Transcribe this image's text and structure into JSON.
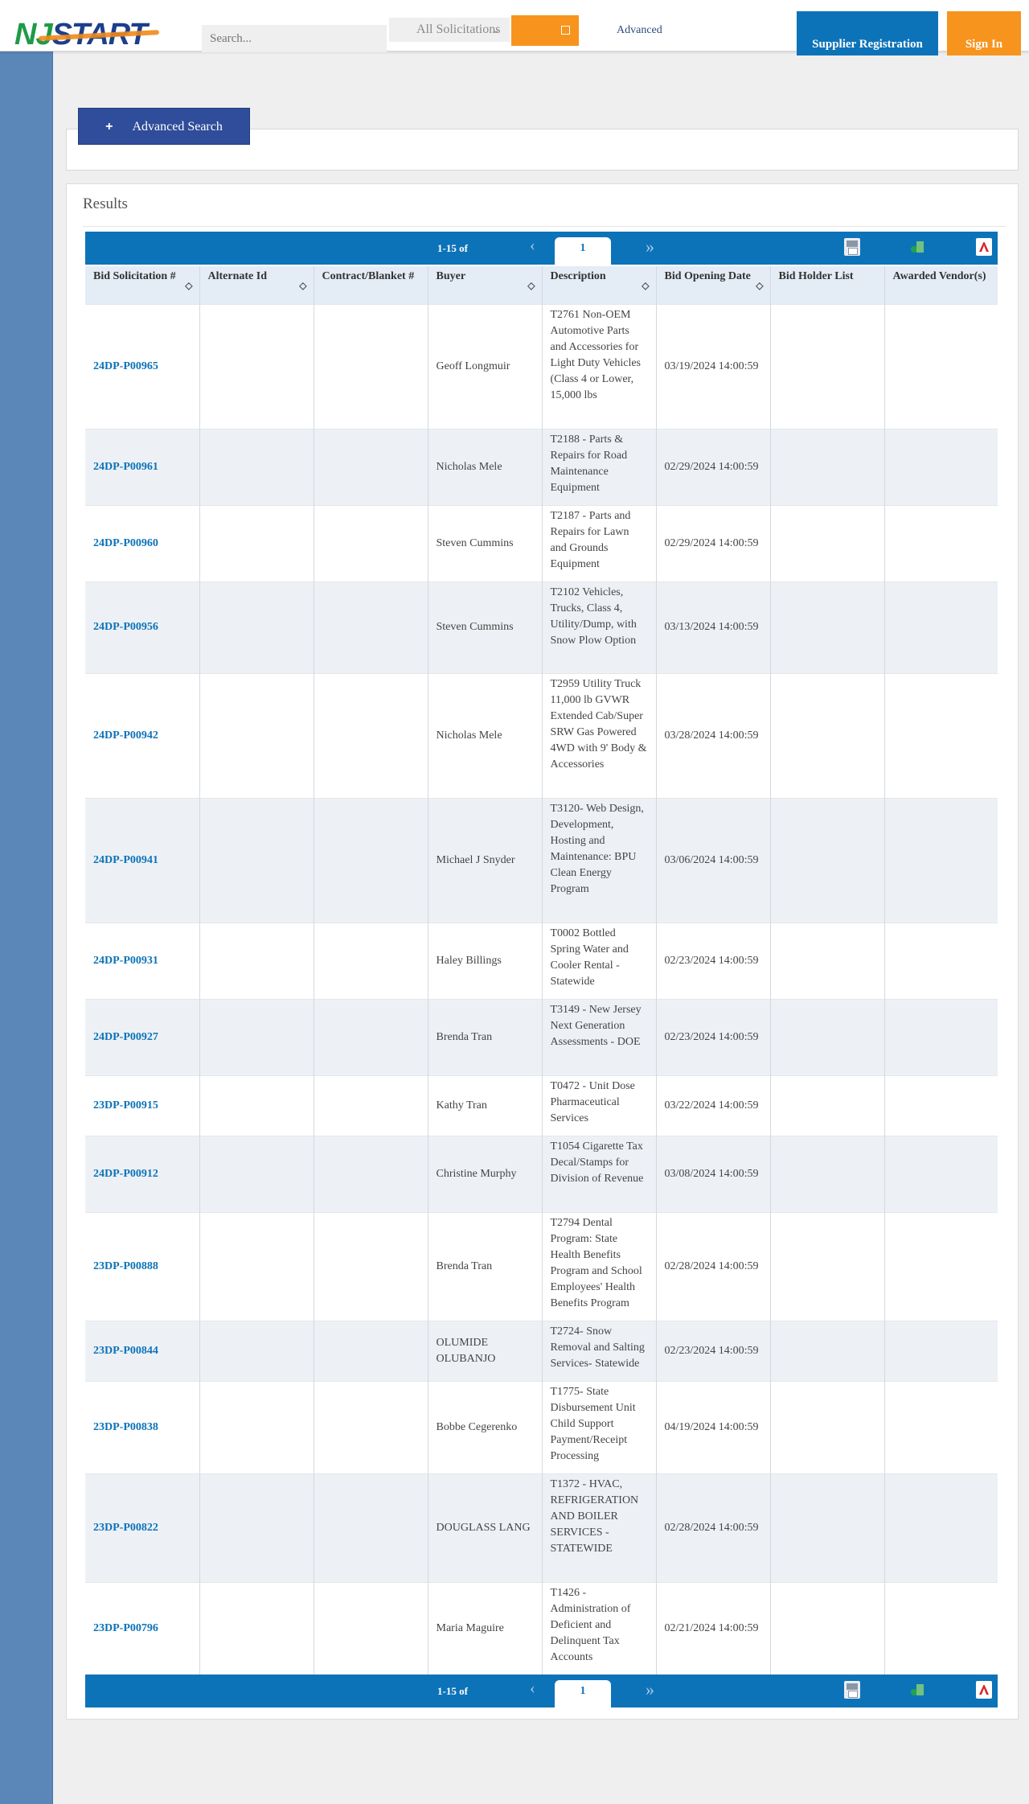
{
  "header": {
    "logo_nj": "NJ",
    "logo_start": "START",
    "search_placeholder": "Search...",
    "scope_label": "All Solicitations",
    "advanced_label": "Advanced",
    "supplier_button": "Supplier Registration",
    "signin_button": "Sign In"
  },
  "colors": {
    "brand_blue": "#0d73b8",
    "accent_orange": "#f7941d",
    "rail_blue": "#5a86b8",
    "adv_button": "#2f4d9a"
  },
  "advanced_search": {
    "label": "Advanced Search"
  },
  "results": {
    "title": "Results",
    "pager_top": {
      "range": "1-15 of",
      "page": "1"
    },
    "pager_bottom": {
      "range": "1-15 of",
      "page": "1"
    },
    "columns": [
      "Bid Solicitation #",
      "Alternate Id",
      "Contract/Blanket #",
      "Buyer",
      "Description",
      "Bid Opening Date",
      "Bid Holder List",
      "Awarded Vendor(s)"
    ],
    "rows": [
      {
        "bid": "24DP-P00965",
        "alt": "",
        "contract": "",
        "buyer": "Geoff Longmuir",
        "desc": "T2761 Non-OEM Automotive Parts and Accessories for Light Duty Vehicles (Class 4 or Lower, 15,000 lbs",
        "date": "03/19/2024 14:00:59",
        "holder": "",
        "vendor": ""
      },
      {
        "bid": "24DP-P00961",
        "alt": "",
        "contract": "",
        "buyer": "Nicholas Mele",
        "desc": "T2188 - Parts & Repairs for Road Maintenance Equipment",
        "date": "02/29/2024 14:00:59",
        "holder": "",
        "vendor": ""
      },
      {
        "bid": "24DP-P00960",
        "alt": "",
        "contract": "",
        "buyer": "Steven Cummins",
        "desc": "T2187 - Parts and Repairs for Lawn and Grounds Equipment",
        "date": "02/29/2024 14:00:59",
        "holder": "",
        "vendor": ""
      },
      {
        "bid": "24DP-P00956",
        "alt": "",
        "contract": "",
        "buyer": "Steven Cummins",
        "desc": "T2102 Vehicles, Trucks, Class 4, Utility/Dump, with Snow Plow Option",
        "date": "03/13/2024 14:00:59",
        "holder": "",
        "vendor": ""
      },
      {
        "bid": "24DP-P00942",
        "alt": "",
        "contract": "",
        "buyer": "Nicholas Mele",
        "desc": "T2959 Utility Truck 11,000 lb GVWR Extended Cab/Super SRW Gas Powered 4WD with 9' Body & Accessories",
        "date": "03/28/2024 14:00:59",
        "holder": "",
        "vendor": ""
      },
      {
        "bid": "24DP-P00941",
        "alt": "",
        "contract": "",
        "buyer": "Michael J Snyder",
        "desc": "T3120- Web Design, Development, Hosting and Maintenance: BPU Clean Energy Program",
        "date": "03/06/2024 14:00:59",
        "holder": "",
        "vendor": ""
      },
      {
        "bid": "24DP-P00931",
        "alt": "",
        "contract": "",
        "buyer": "Haley Billings",
        "desc": "T0002 Bottled Spring Water and Cooler Rental - Statewide",
        "date": "02/23/2024 14:00:59",
        "holder": "",
        "vendor": ""
      },
      {
        "bid": "24DP-P00927",
        "alt": "",
        "contract": "",
        "buyer": "Brenda Tran",
        "desc": "T3149 - New Jersey Next Generation Assessments - DOE",
        "date": "02/23/2024 14:00:59",
        "holder": "",
        "vendor": ""
      },
      {
        "bid": "23DP-P00915",
        "alt": "",
        "contract": "",
        "buyer": "Kathy Tran",
        "desc": "T0472 - Unit Dose Pharmaceutical Services",
        "date": "03/22/2024 14:00:59",
        "holder": "",
        "vendor": ""
      },
      {
        "bid": "24DP-P00912",
        "alt": "",
        "contract": "",
        "buyer": "Christine Murphy",
        "desc": "T1054 Cigarette Tax Decal/Stamps for Division of Revenue",
        "date": "03/08/2024 14:00:59",
        "holder": "",
        "vendor": ""
      },
      {
        "bid": "23DP-P00888",
        "alt": "",
        "contract": "",
        "buyer": "Brenda Tran",
        "desc": "T2794 Dental Program: State Health Benefits Program and School Employees' Health Benefits Program",
        "date": "02/28/2024 14:00:59",
        "holder": "",
        "vendor": ""
      },
      {
        "bid": "23DP-P00844",
        "alt": "",
        "contract": "",
        "buyer": "OLUMIDE OLUBANJO",
        "desc": "T2724- Snow Removal and Salting Services- Statewide",
        "date": "02/23/2024 14:00:59",
        "holder": "",
        "vendor": ""
      },
      {
        "bid": "23DP-P00838",
        "alt": "",
        "contract": "",
        "buyer": "Bobbe Cegerenko",
        "desc": "T1775- State Disbursement Unit Child Support Payment/Receipt Processing",
        "date": "04/19/2024 14:00:59",
        "holder": "",
        "vendor": ""
      },
      {
        "bid": "23DP-P00822",
        "alt": "",
        "contract": "",
        "buyer": "DOUGLASS LANG",
        "desc": "T1372 - HVAC, REFRIGERATION AND BOILER SERVICES - STATEWIDE",
        "date": "02/28/2024 14:00:59",
        "holder": "",
        "vendor": ""
      },
      {
        "bid": "23DP-P00796",
        "alt": "",
        "contract": "",
        "buyer": "Maria Maguire",
        "desc": "T1426 - Administration of Deficient and Delinquent Tax Accounts",
        "date": "02/21/2024 14:00:59",
        "holder": "",
        "vendor": ""
      }
    ]
  }
}
